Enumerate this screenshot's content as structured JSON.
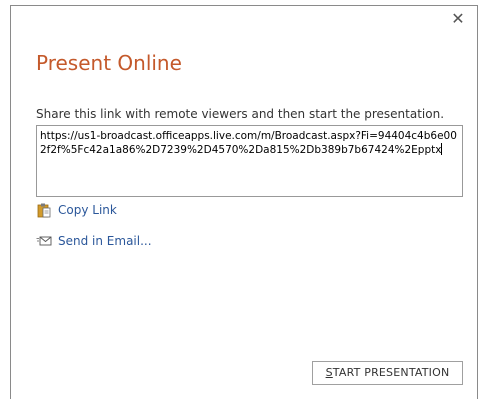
{
  "dialog": {
    "close_glyph": "✕",
    "title": "Present Online",
    "instructions": "Share this link with remote viewers and then start the presentation.",
    "link": "https://us1-broadcast.officeapps.live.com/m/Broadcast.aspx?Fi=94404c4b6e002f2f%5Fc42a1a86%2D7239%2D4570%2Da815%2Db389b7b67424%2Epptx",
    "copy_link_label": "Copy Link",
    "send_email_label": "Send in Email...",
    "start_button": {
      "mnemonic": "S",
      "rest": "TART PRESENTATION"
    }
  },
  "colors": {
    "title": "#c4592b",
    "link_action": "#2b579a",
    "clipboard_icon": "#d29b2c"
  },
  "icons": {
    "close": "close-icon",
    "copy": "clipboard-icon",
    "email": "envelope-icon"
  }
}
